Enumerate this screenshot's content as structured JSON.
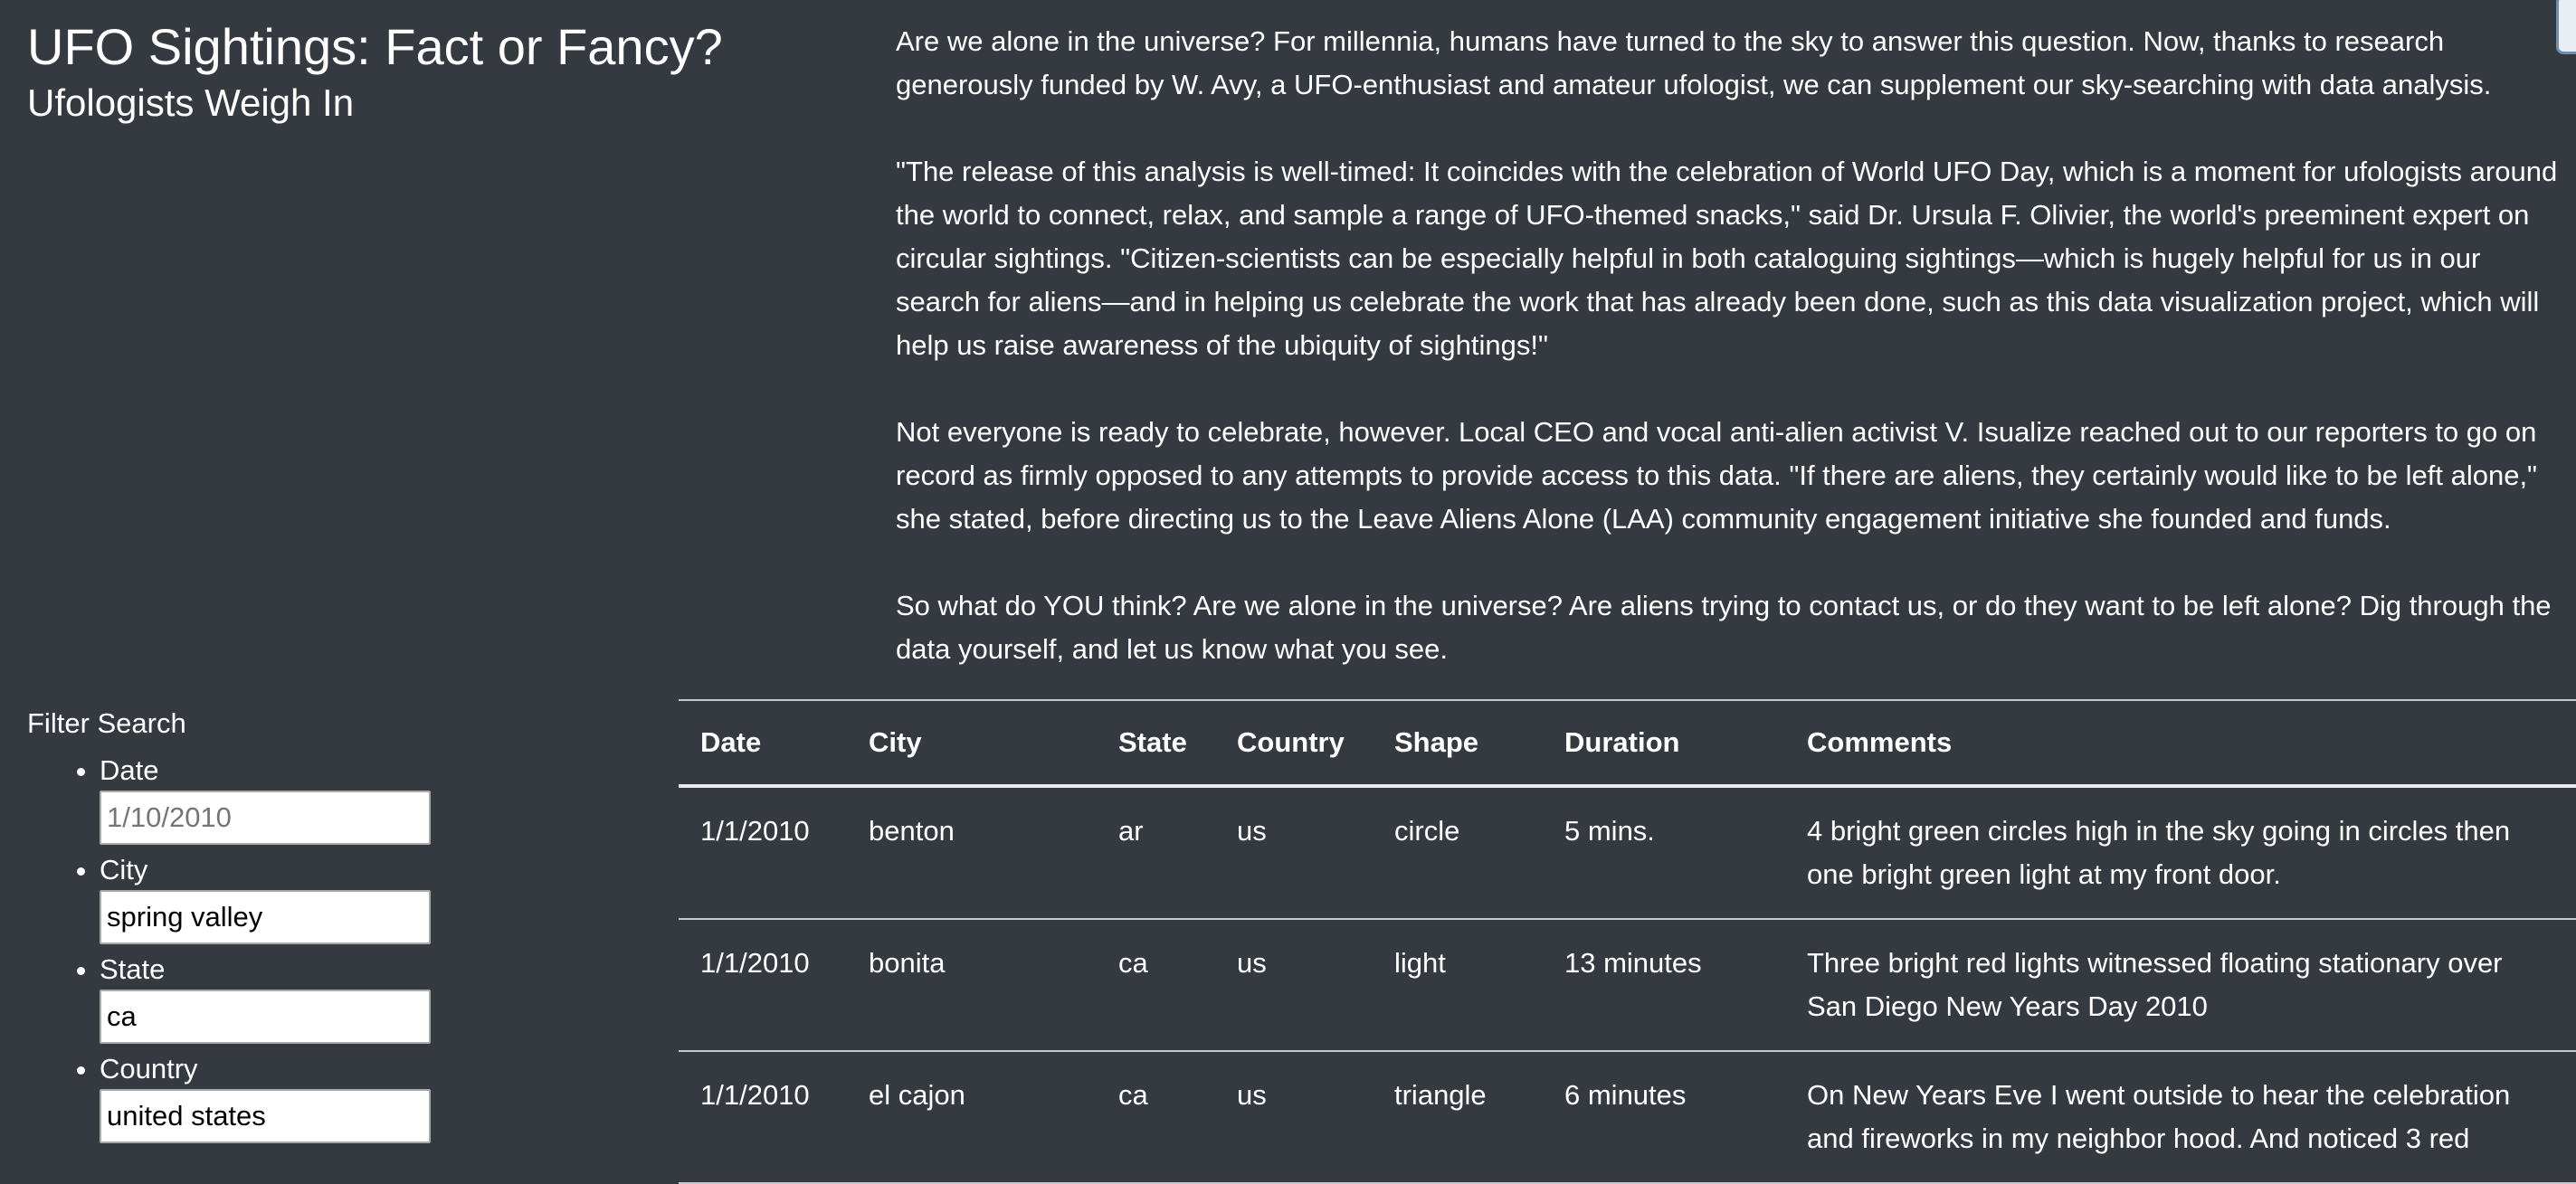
{
  "header": {
    "title": "UFO Sightings: Fact or Fancy?",
    "subtitle": "Ufologists Weigh In"
  },
  "intro": {
    "paragraphs": [
      "Are we alone in the universe? For millennia, humans have turned to the sky to answer this question. Now, thanks to research generously funded by W. Avy, a UFO-enthusiast and amateur ufologist, we can supplement our sky-searching with data analysis.",
      "\"The release of this analysis is well-timed: It coincides with the celebration of World UFO Day, which is a moment for ufologists around the world to connect, relax, and sample a range of UFO-themed snacks,\" said Dr. Ursula F. Olivier, the world's preeminent expert on circular sightings. \"Citizen-scientists can be especially helpful in both cataloguing sightings—which is hugely helpful for us in our search for aliens—and in helping us celebrate the work that has already been done, such as this data visualization project, which will help us raise awareness of the ubiquity of sightings!\"",
      "Not everyone is ready to celebrate, however. Local CEO and vocal anti-alien activist V. Isualize reached out to our reporters to go on record as firmly opposed to any attempts to provide access to this data. \"If there are aliens, they certainly would like to be left alone,\" she stated, before directing us to the Leave Aliens Alone (LAA) community engagement initiative she founded and funds.",
      "So what do YOU think? Are we alone in the universe? Are aliens trying to contact us, or do they want to be left alone? Dig through the data yourself, and let us know what you see."
    ]
  },
  "filters": {
    "heading": "Filter Search",
    "items": [
      {
        "label": "Date",
        "value": "",
        "placeholder": "1/10/2010"
      },
      {
        "label": "City",
        "value": "spring valley",
        "placeholder": ""
      },
      {
        "label": "State",
        "value": "ca",
        "placeholder": ""
      },
      {
        "label": "Country",
        "value": "united states",
        "placeholder": ""
      }
    ]
  },
  "table": {
    "headers": [
      "Date",
      "City",
      "State",
      "Country",
      "Shape",
      "Duration",
      "Comments"
    ],
    "rows": [
      [
        "1/1/2010",
        "benton",
        "ar",
        "us",
        "circle",
        "5 mins.",
        "4 bright green circles high in the sky going in circles then one bright green light at my front door."
      ],
      [
        "1/1/2010",
        "bonita",
        "ca",
        "us",
        "light",
        "13 minutes",
        "Three bright red lights witnessed floating stationary over San Diego New Years Day 2010"
      ],
      [
        "1/1/2010",
        "el cajon",
        "ca",
        "us",
        "triangle",
        "6 minutes",
        "On New Years Eve I went outside to hear the celebration and fireworks in my neighbor hood. And noticed 3 red"
      ]
    ]
  },
  "colors": {
    "background": "#343a40",
    "text": "#ffffff",
    "row_divider": "#c7c9cb"
  }
}
